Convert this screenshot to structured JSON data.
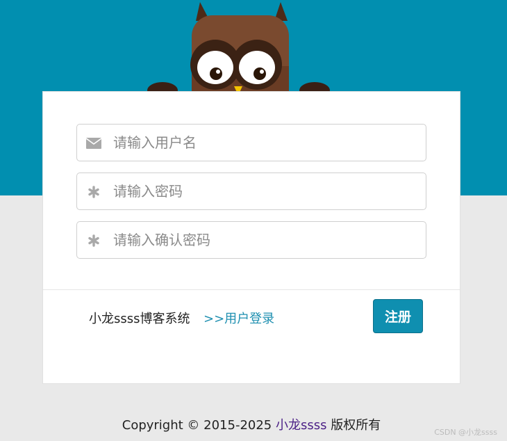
{
  "form": {
    "username_placeholder": "请输入用户名",
    "password_placeholder": "请输入密码",
    "confirm_placeholder": "请输入确认密码"
  },
  "actions": {
    "system_name": "小龙ssss博客系统",
    "login_link": ">>用户登录",
    "register_label": "注册"
  },
  "footer": {
    "copyright_prefix": "Copyright © 2015-2025",
    "author": "小龙ssss",
    "suffix": "版权所有"
  },
  "watermark": "CSDN @小龙ssss",
  "colors": {
    "brand": "#018fb0",
    "background": "#e9e9e9",
    "link": "#1e8fb0",
    "author": "#4b1f86"
  },
  "icons": {
    "username": "envelope-icon",
    "password": "asterisk-icon",
    "confirm": "asterisk-icon"
  }
}
